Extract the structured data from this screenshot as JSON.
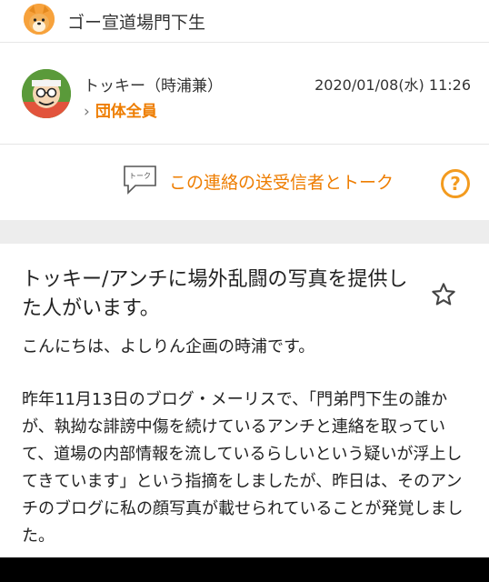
{
  "header": {
    "group_name": "ゴー宣道場門下生"
  },
  "post_meta": {
    "author": "トッキー（時浦兼）",
    "datetime": "2020/01/08(水) 11:26",
    "recipient": "団体全員",
    "talk_icon_label": "トーク",
    "talk_link": "この連絡の送受信者とトーク"
  },
  "post": {
    "title": "トッキー/アンチに場外乱闘の写真を提供した人がいます。",
    "greeting": "こんにちは、よしりん企画の時浦です。",
    "body": "昨年11月13日のブログ・メーリスで、「門弟門下生の誰かが、執拗な誹謗中傷を続けているアンチと連絡を取っていて、道場の内部情報を流しているらしいという疑いが浮上してきています」という指摘をしましたが、昨日は、そのアンチのブログに私の顔写真が載せられていることが発覚しました。"
  },
  "colors": {
    "accent": "#ee7d00",
    "help": "#f39b1f",
    "divider_bg": "#ededed"
  },
  "icons": {
    "group": "shiba-dog-avatar",
    "author": "cartoon-avatar",
    "talk": "speech-bubble-icon",
    "help": "question-circle-icon",
    "favorite": "star-outline-icon",
    "chevron": "chevron-right-icon"
  }
}
